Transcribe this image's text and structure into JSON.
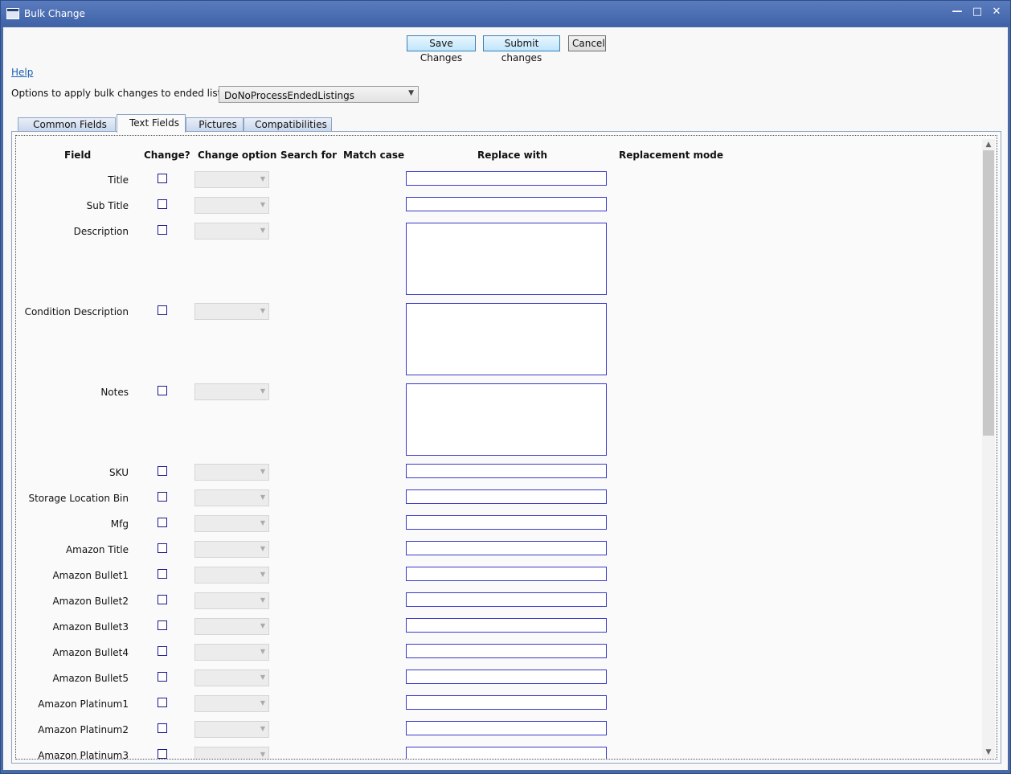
{
  "window": {
    "title": "Bulk Change",
    "minimize": "—",
    "maximize": "□",
    "close": "✕"
  },
  "toolbar": {
    "save": "Save Changes",
    "submit": "Submit changes",
    "cancel": "Cancel"
  },
  "help": "Help",
  "options": {
    "label": "Options to apply bulk changes to ended listings:",
    "selected": "DoNoProcessEndedListings"
  },
  "tabs": [
    "Common Fields",
    "Text Fields",
    "Pictures",
    "Compatibilities"
  ],
  "active_tab": "Text Fields",
  "headers": {
    "field": "Field",
    "change": "Change?",
    "change_option": "Change option",
    "search_for": "Search for",
    "match_case": "Match case",
    "replace_with": "Replace with",
    "replacement_mode": "Replacement mode"
  },
  "fields": [
    {
      "label": "Title",
      "multiline": false,
      "checked": false
    },
    {
      "label": "Sub Title",
      "multiline": false,
      "checked": false
    },
    {
      "label": "Description",
      "multiline": true,
      "checked": false
    },
    {
      "label": "Condition Description",
      "multiline": true,
      "checked": false
    },
    {
      "label": "Notes",
      "multiline": true,
      "checked": false
    },
    {
      "label": "SKU",
      "multiline": false,
      "checked": false
    },
    {
      "label": "Storage Location Bin",
      "multiline": false,
      "checked": false
    },
    {
      "label": "Mfg",
      "multiline": false,
      "checked": false
    },
    {
      "label": "Amazon Title",
      "multiline": false,
      "checked": false
    },
    {
      "label": "Amazon Bullet1",
      "multiline": false,
      "checked": false
    },
    {
      "label": "Amazon Bullet2",
      "multiline": false,
      "checked": false
    },
    {
      "label": "Amazon Bullet3",
      "multiline": false,
      "checked": false
    },
    {
      "label": "Amazon Bullet4",
      "multiline": false,
      "checked": false
    },
    {
      "label": "Amazon Bullet5",
      "multiline": false,
      "checked": false
    },
    {
      "label": "Amazon Platinum1",
      "multiline": false,
      "checked": false
    },
    {
      "label": "Amazon Platinum2",
      "multiline": false,
      "checked": false
    },
    {
      "label": "Amazon Platinum3",
      "multiline": false,
      "checked": false
    }
  ],
  "icons": {
    "dropdown": "chevron-down-icon",
    "scroll_up": "chevron-up-icon",
    "scroll_down": "chevron-down-icon"
  }
}
